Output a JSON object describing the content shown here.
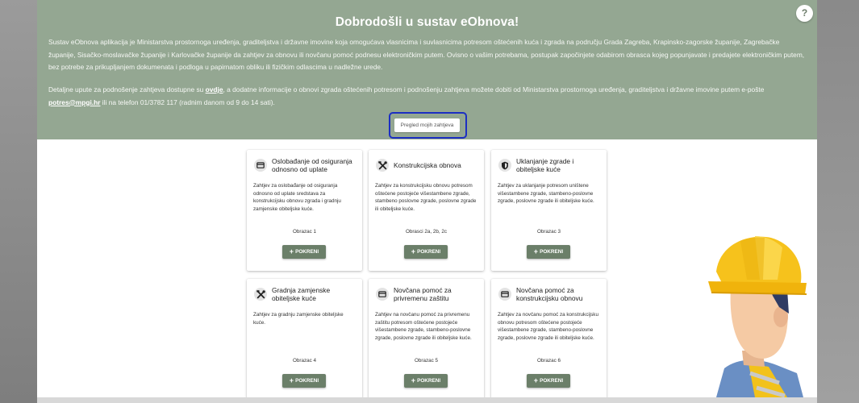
{
  "header": {
    "title": "Dobrodošli u sustav eObnova!",
    "help_label": "?",
    "intro": "Sustav eObnova aplikacija je Ministarstva prostornoga uređenja, graditeljstva i državne imovine koja omogućava vlasnicima i suvlasnicima potresom oštećenih kuća i zgrada na području Grada Zagreba, Krapinsko-zagorske županije, Zagrebačke županije, Sisačko-moslavačke županije i Karlovačke županije da zahtjev za obnovu ili novčanu pomoć podnesu elektroničkim putem. Ovisno o vašim potrebama, postupak započinjete odabirom obrasca kojeg popunjavate i predajete elektroničkim putem, bez potrebe za prikupljanjem dokumenata i podloga u papirnatom obliku ili fizičkim odlascima u nadležne urede.",
    "info_before_link": "Detaljne upute za podnošenje zahtjeva dostupne su ",
    "info_link": "ovdje",
    "info_middle": ", a dodatne informacije o obnovi zgrada oštećenih potresom i podnošenju zahtjeva možete dobiti od Ministarstva prostornoga uređenja, graditeljstva i državne imovine putem e-pošte ",
    "email": "potres@mpgi.hr",
    "info_after_email": " ili na telefon 01/3782 117 (radnim danom od 9 do 14 sati).",
    "review_button": "Pregled mojih zahtjeva"
  },
  "run_label": "POKRENI",
  "run_icon": "plus-icon",
  "cards": [
    {
      "icon": "card-icon",
      "title": "Oslobađanje od osiguranja odnosno od uplate",
      "description": "Zahtjev za oslobađanje od osiguranja odnosno od uplate sredstava za konstrukcijsku obnovu zgrada i gradnju zamjenske obiteljske kuće.",
      "form": "Obrazac 1"
    },
    {
      "icon": "tools-icon",
      "title": "Konstrukcijska obnova",
      "description": "Zahtjev za konstrukcijsku obnovu potresom oštećene postojeće višestambene zgrade, stambeno poslovne zgrade, poslovne zgrade ili obiteljske kuće.",
      "form": "Obrasci 2a, 2b, 2c"
    },
    {
      "icon": "shield-icon",
      "title": "Uklanjanje zgrade i obiteljske kuće",
      "description": "Zahtjev za uklanjanje potresom uništene višestambene zgrade, stambeno-poslovne zgrade, poslovne zgrade ili obiteljske kuće.",
      "form": "Obrazac 3"
    },
    {
      "icon": "tools-icon",
      "title": "Gradnja zamjenske obiteljske kuće",
      "description": "Zahtjev za gradnju zamjenske obiteljske kuće.",
      "form": "Obrazac 4"
    },
    {
      "icon": "card-icon",
      "title": "Novčana pomoć za privremenu zaštitu",
      "description": "Zahtjev na novčanu pomoć za privremenu zaštitu potresom oštećene postojeće višestambene zgrade, stambeno-poslovne zgrade, poslovne zgrade ili obiteljske kuće.",
      "form": "Obrazac 5"
    },
    {
      "icon": "card-icon",
      "title": "Novčana pomoć za konstrukcijsku obnovu",
      "description": "Zahtjev za novčanu pomoć za konstrukcijsku obnovu potresom oštećene postojeće višestambene zgrade, stambeno-poslovne zgrade, poslovne zgrade ili obiteljske kuće.",
      "form": "Obrazac 6"
    }
  ],
  "colors": {
    "hero_background": "#94a792",
    "button_green": "#6b7f69",
    "highlight_border": "#1c2fc2"
  }
}
